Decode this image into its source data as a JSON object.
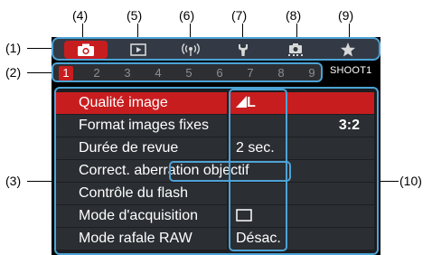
{
  "callouts": {
    "c1": "(1)",
    "c2": "(2)",
    "c3": "(3)",
    "c4": "(4)",
    "c5": "(5)",
    "c6": "(6)",
    "c7": "(7)",
    "c8": "(8)",
    "c9": "(9)",
    "c10": "(10)"
  },
  "tabs": [
    {
      "icon": "camera-icon",
      "active": true
    },
    {
      "icon": "playback-icon",
      "active": false
    },
    {
      "icon": "wireless-icon",
      "active": false
    },
    {
      "icon": "wrench-icon",
      "active": false
    },
    {
      "icon": "custom-function-icon",
      "active": false
    },
    {
      "icon": "star-icon",
      "active": false
    }
  ],
  "pages": {
    "numbers": [
      "1",
      "2",
      "3",
      "4",
      "5",
      "6",
      "7",
      "8",
      "9"
    ],
    "active_page": "1",
    "menu_name": "SHOOT1"
  },
  "menu": {
    "items": [
      {
        "label": "Qualité image",
        "value": "L"
      },
      {
        "label": "Format images fixes",
        "value": "3:2"
      },
      {
        "label": "Durée de revue",
        "value": "2 sec."
      },
      {
        "label": "Correct. aberration objectif",
        "value": ""
      },
      {
        "label": "Contrôle du flash",
        "value": ""
      },
      {
        "label": "Mode d'acquisition",
        "value": ""
      },
      {
        "label": "Mode rafale RAW",
        "value": "Désac."
      }
    ]
  },
  "colors": {
    "accent": "#c81d1f",
    "highlight_border": "#4da3d6",
    "menu_bg": "#2b2e33",
    "text": "#ffffff"
  }
}
